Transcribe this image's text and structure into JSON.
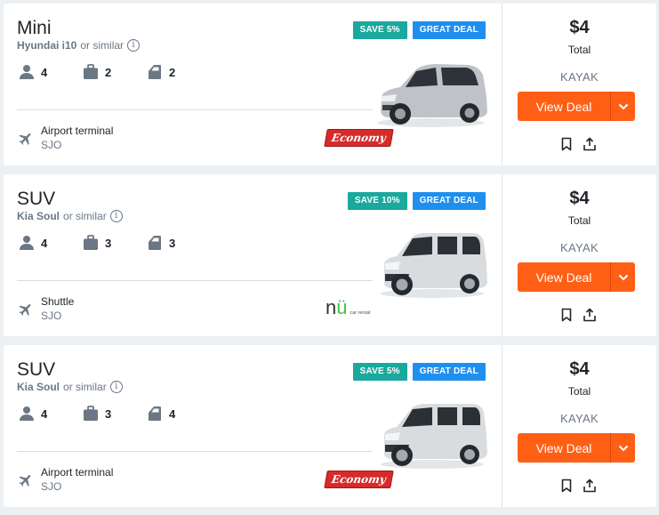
{
  "cards": [
    {
      "category": "Mini",
      "model": "Hyundai i10",
      "similar": "or similar",
      "passengers": "4",
      "bags": "2",
      "doors": "2",
      "location": "Airport terminal",
      "code": "SJO",
      "save_badge": "SAVE 5%",
      "deal_badge": "GREAT DEAL",
      "agency_logo": "Economy",
      "price": "$4",
      "total_label": "Total",
      "provider": "KAYAK",
      "cta": "View Deal",
      "car_color": "#bfc3c7"
    },
    {
      "category": "SUV",
      "model": "Kia Soul",
      "similar": "or similar",
      "passengers": "4",
      "bags": "3",
      "doors": "3",
      "location": "Shuttle",
      "code": "SJO",
      "save_badge": "SAVE 10%",
      "deal_badge": "GREAT DEAL",
      "agency_logo": "nü",
      "agency_logo_sub": "car rental",
      "price": "$4",
      "total_label": "Total",
      "provider": "KAYAK",
      "cta": "View Deal",
      "car_color": "#d9dcdf"
    },
    {
      "category": "SUV",
      "model": "Kia Soul",
      "similar": "or similar",
      "passengers": "4",
      "bags": "3",
      "doors": "4",
      "location": "Airport terminal",
      "code": "SJO",
      "save_badge": "SAVE 5%",
      "deal_badge": "GREAT DEAL",
      "agency_logo": "Economy",
      "price": "$4",
      "total_label": "Total",
      "provider": "KAYAK",
      "cta": "View Deal",
      "car_color": "#d9dcdf"
    }
  ],
  "colors": {
    "cta": "#ff5f14",
    "save_badge": "#19a99d",
    "deal_badge": "#1e8fef",
    "economy_logo": "#d52b2b"
  },
  "icons": {
    "info": "info-circle-icon",
    "passengers": "person-icon",
    "bags": "suitcase-icon",
    "doors": "car-door-icon",
    "location": "airplane-icon",
    "dropdown": "chevron-down-icon",
    "save": "bookmark-icon",
    "share": "share-icon"
  }
}
